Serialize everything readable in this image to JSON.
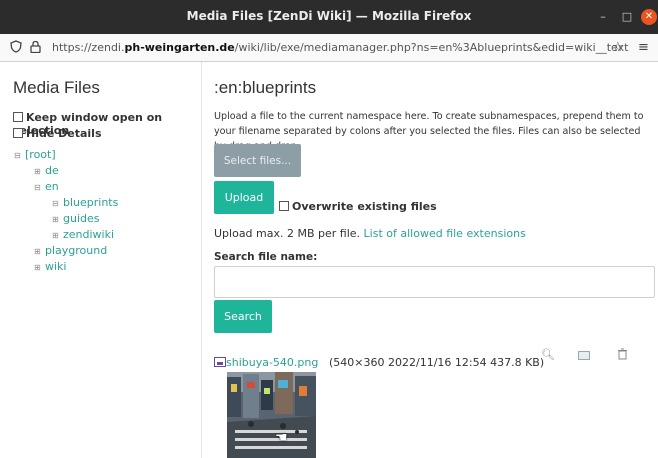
{
  "window": {
    "title": "Media Files [ZenDi Wiki] — Mozilla Firefox",
    "min_icon": "minimize-icon",
    "max_icon": "maximize-icon",
    "close_icon": "close-icon"
  },
  "url": {
    "prefix": "https://zendi.",
    "domain": "ph-weingarten.de",
    "path": "/wiki/lib/exe/mediamanager.php?ns=en%3Ablueprints&edid=wiki__text"
  },
  "sidebar": {
    "title": "Media Files",
    "keep_open_label": "Keep window open on selection",
    "hide_details_label": "Hide Details",
    "tree": [
      {
        "label": "[root]",
        "toggle": "⊟"
      },
      {
        "label": "de",
        "toggle": "⊞"
      },
      {
        "label": "en",
        "toggle": "⊟"
      },
      {
        "label": "blueprints",
        "toggle": "⊟"
      },
      {
        "label": "guides",
        "toggle": "⊞"
      },
      {
        "label": "zendiwiki",
        "toggle": "⊞"
      },
      {
        "label": "playground",
        "toggle": "⊞"
      },
      {
        "label": "wiki",
        "toggle": "⊞"
      }
    ]
  },
  "main": {
    "namespace_title": ":en:blueprints",
    "intro_text": "Upload a file to the current namespace here. To create subnamespaces, prepend them to your filename separated by colons after you selected the files. Files can also be selected by drag and drop.",
    "select_files_label": "Select files...",
    "upload_label": "Upload",
    "overwrite_label": "Overwrite existing files",
    "max_info": "Upload max. 2 MB per file.",
    "allowed_link": "List of allowed file extensions",
    "search_label": "Search file name:",
    "search_value": "",
    "search_button": "Search",
    "file": {
      "name": "shibuya-540.png",
      "meta": "(540×360 2022/11/16 12:54 437.8 KB)"
    }
  },
  "colors": {
    "accent": "#1fb59a",
    "link": "#2aa198",
    "disabled_button": "#8e9ea6",
    "titlebar": "#2c2c2c",
    "close": "#e95420"
  }
}
